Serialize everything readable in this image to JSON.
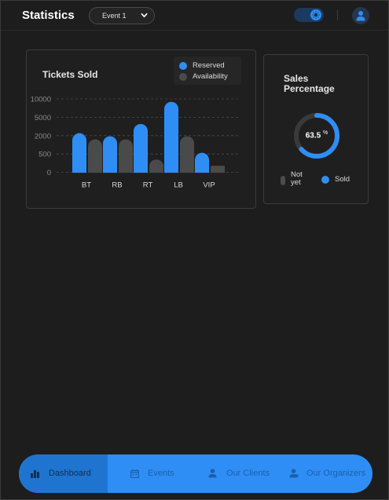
{
  "header": {
    "title": "Statistics",
    "event_select": "Event 1"
  },
  "tickets": {
    "title": "Tickets Sold",
    "legend": [
      "Reserved",
      "Availability"
    ]
  },
  "sales": {
    "title_line1": "Sales",
    "title_line2": "Percentage",
    "percent": "63.5",
    "percent_sign": "%",
    "legend_not_yet_1": "Not",
    "legend_not_yet_2": "yet",
    "legend_sold": "Sold"
  },
  "nav": {
    "dashboard": "Dashboard",
    "events": "Events",
    "clients": "Our Clients",
    "organizers": "Our Organizers"
  },
  "colors": {
    "accent": "#2f8ef5",
    "availability": "#4a4a4a"
  },
  "chart_data": {
    "type": "bar",
    "categories": [
      "BT",
      "RB",
      "RT",
      "LB",
      "VIP"
    ],
    "y_ticks": [
      "0",
      "500",
      "2000",
      "5000",
      "10000"
    ],
    "series": [
      {
        "name": "Reserved",
        "values": [
          2400,
          1950,
          3900,
          9200,
          600
        ]
      },
      {
        "name": "Availability",
        "values": [
          1700,
          1700,
          350,
          1950,
          180
        ]
      }
    ],
    "grid": true,
    "legend_position": "top-right"
  }
}
